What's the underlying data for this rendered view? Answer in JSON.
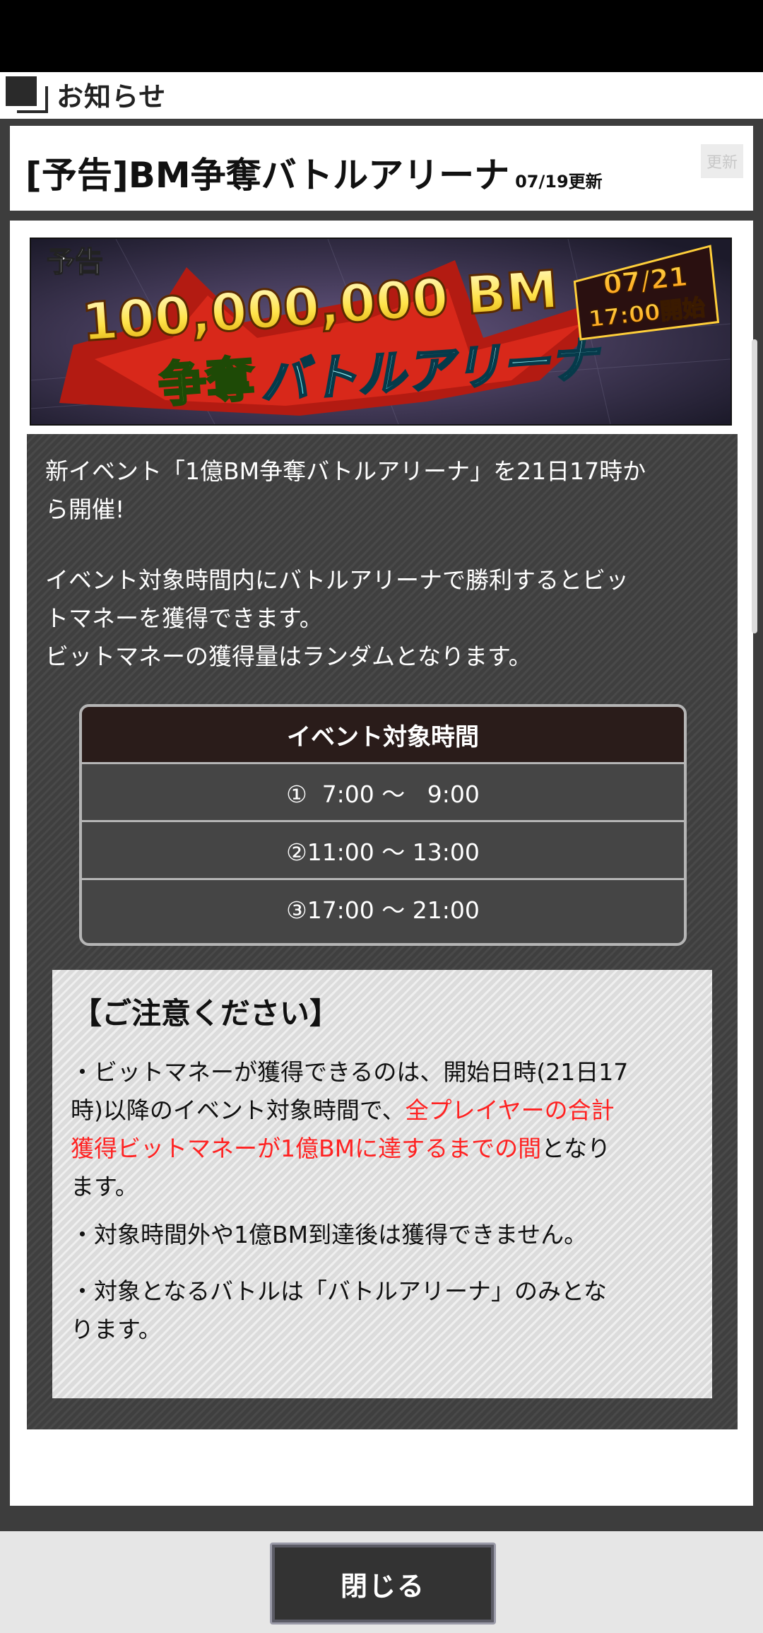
{
  "header": {
    "title": "お知らせ"
  },
  "notice": {
    "title": "[予告]BM争奪バトルアリーナ",
    "date": "07/19更新",
    "update_label": "更新"
  },
  "banner": {
    "tag": "予告",
    "amount": "100,000,000 BM",
    "subtitle_a": "争奪",
    "subtitle_b": "バトルアリーナ",
    "date": "07/21",
    "time": "17:00開始"
  },
  "body": {
    "p1": [
      "新イベント「1億BM争奪バトルアリーナ」を21日17時か",
      "ら開催!"
    ],
    "p2": [
      "イベント対象時間内にバトルアリーナで勝利するとビッ",
      "トマネーを獲得できます。",
      "ビットマネーの獲得量はランダムとなります。"
    ]
  },
  "schedule": {
    "header": "イベント対象時間",
    "rows": [
      "①  7:00 〜   9:00",
      "②11:00 〜 13:00",
      "③17:00 〜 21:00"
    ]
  },
  "caution": {
    "title": "【ご注意ください】",
    "line1": "・ビットマネーが獲得できるのは、開始日時(21日17",
    "line2_a": "時)以降のイベント対象時間で、",
    "line2_red": "全プレイヤーの合計",
    "line3_red": "獲得ビットマネーが1億BMに達するまでの間",
    "line3_b": "となり",
    "line4": "ます。",
    "p2": "・対象時間外や1億BM到達後は獲得できません。",
    "p3": [
      "・対象となるバトルは「バトルアリーナ」のみとな",
      "ります。"
    ]
  },
  "footer": {
    "close_label": "閉じる"
  },
  "colors": {
    "highlight": "#ff2222",
    "panel": "#3f3f3f",
    "table_header": "#2a1c1a"
  }
}
